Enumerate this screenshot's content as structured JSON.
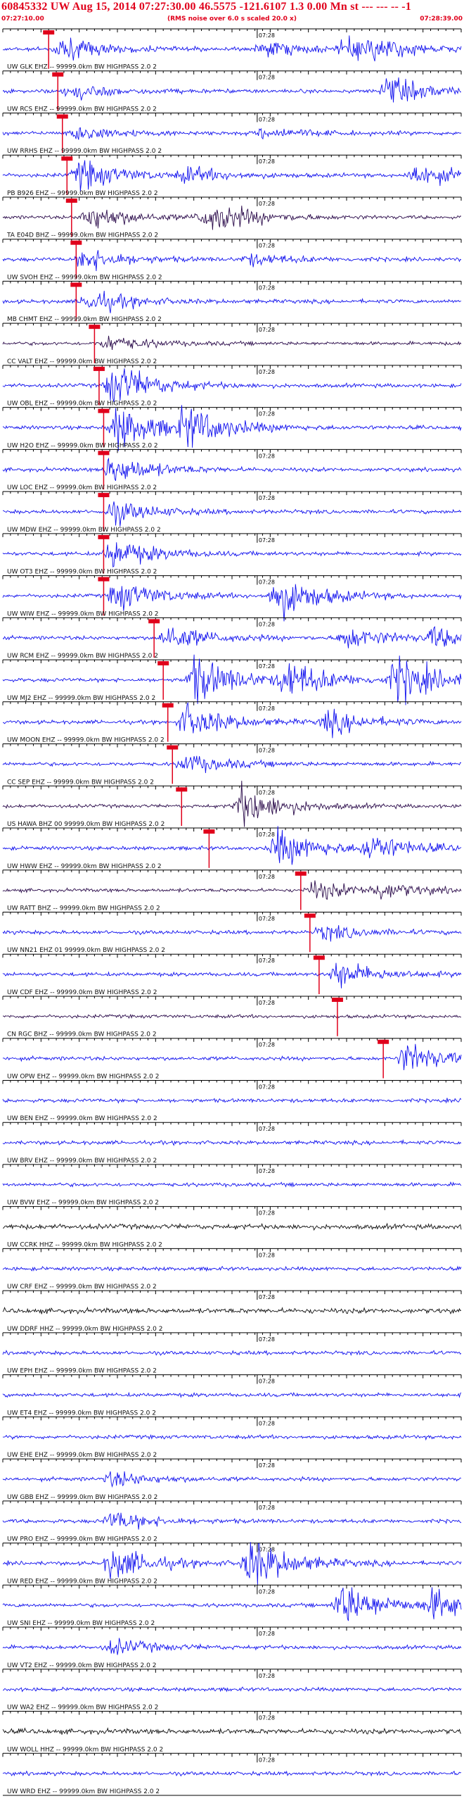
{
  "header": {
    "title": "60845332 UW Aug 15, 2014 07:27:30.00   46.5575 -121.6107  1.3 0.00 Mn st --- --- --  -1",
    "subtitle": "(RMS noise over 6.0 s scaled 20.0 x)",
    "start_time": "07:27:10.00",
    "end_time": "07:28:39.00"
  },
  "tick_label": "07:28",
  "colors": {
    "red": "#e0001b",
    "blue": "#1010ee",
    "dark": "#2a0a4a",
    "black": "#111111",
    "grid": "#000000"
  },
  "traces": [
    {
      "label": "UW GLK EHZ -- 99999.0km BW  HIGHPASS  2.0  2",
      "color": "blue",
      "pick": 0.1,
      "events": [
        [
          0.11,
          3.0
        ],
        [
          0.55,
          2.0
        ],
        [
          0.73,
          2.5
        ],
        [
          0.79,
          2.0
        ]
      ]
    },
    {
      "label": "UW RCS EHZ -- 99999.0km BW  HIGHPASS  2.0  2",
      "color": "blue",
      "pick": 0.12,
      "events": [
        [
          0.13,
          2.0
        ],
        [
          0.82,
          3.5
        ]
      ]
    },
    {
      "label": "UW RRHS EHZ -- 99999.0km BW  HIGHPASS  2.0  2",
      "color": "blue",
      "pick": 0.13,
      "events": [
        [
          0.14,
          2.0
        ],
        [
          0.55,
          1.5
        ]
      ]
    },
    {
      "label": "PB B926 EHZ -- 99999.0km BW  HIGHPASS  2.0  2",
      "color": "blue",
      "pick": 0.14,
      "events": [
        [
          0.15,
          4.0
        ],
        [
          0.38,
          2.0
        ],
        [
          0.88,
          3.0
        ]
      ]
    },
    {
      "label": "TA E04D BHZ -- 99999.0km BW  HIGHPASS  2.0  2",
      "color": "dark",
      "pick": 0.15,
      "events": [
        [
          0.17,
          3.5
        ],
        [
          0.42,
          2.5
        ],
        [
          0.45,
          2.0
        ]
      ]
    },
    {
      "label": "UW SVOH EHZ -- 99999.0km BW  HIGHPASS  2.0  2",
      "color": "blue",
      "pick": 0.16,
      "events": [
        [
          0.16,
          3.0
        ],
        [
          0.52,
          1.5
        ]
      ]
    },
    {
      "label": "MB CHMT EHZ -- 99999.0km BW  HIGHPASS  2.0  2",
      "color": "blue",
      "pick": 0.16,
      "events": [
        [
          0.17,
          3.0
        ]
      ]
    },
    {
      "label": "CC VALT EHZ -- 99999.0km BW  HIGHPASS  2.0  2",
      "color": "dark",
      "pick": 0.2,
      "events": [
        [
          0.21,
          2.0
        ]
      ]
    },
    {
      "label": "UW OBL EHZ -- 99999.0km BW  HIGHPASS  2.0  2",
      "color": "blue",
      "pick": 0.21,
      "events": [
        [
          0.22,
          6.0
        ]
      ]
    },
    {
      "label": "UW H2O EHZ -- 99999.0km BW  HIGHPASS  2.0  2",
      "color": "blue",
      "pick": 0.22,
      "events": [
        [
          0.23,
          6.0
        ],
        [
          0.38,
          5.0
        ]
      ]
    },
    {
      "label": "UW LOC EHZ -- 99999.0km BW  HIGHPASS  2.0  2",
      "color": "blue",
      "pick": 0.22,
      "events": [
        [
          0.22,
          4.0
        ]
      ]
    },
    {
      "label": "UW MDW EHZ -- 99999.0km BW  HIGHPASS  2.0  2",
      "color": "blue",
      "pick": 0.22,
      "events": [
        [
          0.22,
          3.0
        ]
      ]
    },
    {
      "label": "UW OT3 EHZ -- 99999.0km BW  HIGHPASS  2.0  2",
      "color": "blue",
      "pick": 0.22,
      "events": [
        [
          0.22,
          4.0
        ]
      ]
    },
    {
      "label": "UW WIW EHZ -- 99999.0km BW  HIGHPASS  2.0  2",
      "color": "blue",
      "pick": 0.22,
      "events": [
        [
          0.23,
          4.0
        ],
        [
          0.58,
          6.0
        ]
      ]
    },
    {
      "label": "UW RCM EHZ -- 99999.0km BW  HIGHPASS  2.0  2",
      "color": "blue",
      "pick": 0.33,
      "events": [
        [
          0.34,
          3.5
        ],
        [
          0.73,
          3.0
        ],
        [
          0.92,
          2.5
        ]
      ]
    },
    {
      "label": "UW MJ2 EHZ -- 99999.0km BW  HIGHPASS  2.0  2",
      "color": "blue",
      "pick": 0.35,
      "events": [
        [
          0.4,
          6.5
        ],
        [
          0.6,
          5.0
        ],
        [
          0.84,
          6.0
        ]
      ]
    },
    {
      "label": "UW MOON EHZ -- 99999.0km BW  HIGHPASS  2.0  2",
      "color": "blue",
      "pick": 0.36,
      "events": [
        [
          0.38,
          4.5
        ],
        [
          0.69,
          3.0
        ]
      ]
    },
    {
      "label": "CC SEP EHZ -- 99999.0km BW  HIGHPASS  2.0  2",
      "color": "blue",
      "pick": 0.37,
      "events": [
        [
          0.38,
          2.5
        ]
      ]
    },
    {
      "label": "US HAWA BHZ 00 99999.0km BW  HIGHPASS  2.0  2",
      "color": "dark",
      "pick": 0.39,
      "events": [
        [
          0.5,
          5.5
        ]
      ]
    },
    {
      "label": "UW HWW EHZ -- 99999.0km BW  HIGHPASS  2.0  2",
      "color": "blue",
      "pick": 0.45,
      "events": [
        [
          0.58,
          5.0
        ],
        [
          0.78,
          3.5
        ]
      ]
    },
    {
      "label": "UW RATT BHZ -- 99999.0km BW  HIGHPASS  2.0  2",
      "color": "dark",
      "pick": 0.65,
      "events": [
        [
          0.66,
          2.5
        ],
        [
          0.8,
          2.0
        ]
      ]
    },
    {
      "label": "UW NN21 EHZ 01 99999.0km BW  HIGHPASS  2.0  2",
      "color": "blue",
      "pick": 0.67,
      "events": [
        [
          0.68,
          2.0
        ]
      ]
    },
    {
      "label": "UW CDF EHZ -- 99999.0km BW  HIGHPASS  2.0  2",
      "color": "blue",
      "pick": 0.69,
      "events": [
        [
          0.71,
          3.5
        ]
      ]
    },
    {
      "label": "CN RGC BHZ -- 99999.0km BW  HIGHPASS  2.0  2",
      "color": "dark",
      "pick": 0.73,
      "events": []
    },
    {
      "label": "UW OPW EHZ -- 99999.0km BW  HIGHPASS  2.0  2",
      "color": "blue",
      "pick": 0.83,
      "events": [
        [
          0.86,
          4.0
        ]
      ]
    },
    {
      "label": "UW BEN EHZ -- 99999.0km BW  HIGHPASS  2.0  2",
      "color": "blue",
      "pick": null,
      "events": []
    },
    {
      "label": "UW BRV EHZ -- 99999.0km BW  HIGHPASS  2.0  2",
      "color": "blue",
      "pick": null,
      "events": []
    },
    {
      "label": "UW BVW EHZ -- 99999.0km BW  HIGHPASS  2.0  2",
      "color": "blue",
      "pick": null,
      "events": []
    },
    {
      "label": "UW CCRK HHZ -- 99999.0km BW  HIGHPASS  2.0  2",
      "color": "black",
      "pick": null,
      "events": []
    },
    {
      "label": "UW CRF EHZ -- 99999.0km BW  HIGHPASS  2.0  2",
      "color": "blue",
      "pick": null,
      "events": []
    },
    {
      "label": "UW DDRF HHZ -- 99999.0km BW  HIGHPASS  2.0  2",
      "color": "black",
      "pick": null,
      "events": []
    },
    {
      "label": "UW EPH EHZ -- 99999.0km BW  HIGHPASS  2.0  2",
      "color": "blue",
      "pick": null,
      "events": []
    },
    {
      "label": "UW ET4 EHZ -- 99999.0km BW  HIGHPASS  2.0  2",
      "color": "blue",
      "pick": null,
      "events": []
    },
    {
      "label": "UW EHE EHZ -- 99999.0km BW  HIGHPASS  2.0  2",
      "color": "blue",
      "pick": null,
      "events": []
    },
    {
      "label": "UW GBB EHZ -- 99999.0km BW  HIGHPASS  2.0  2",
      "color": "blue",
      "pick": null,
      "events": [
        [
          0.22,
          2.0
        ]
      ]
    },
    {
      "label": "UW PRO EHZ -- 99999.0km BW  HIGHPASS  2.0  2",
      "color": "blue",
      "pick": null,
      "events": [
        [
          0.22,
          2.5
        ]
      ]
    },
    {
      "label": "UW RED EHZ -- 99999.0km BW  HIGHPASS  2.0  2",
      "color": "blue",
      "pick": null,
      "events": [
        [
          0.22,
          4.5
        ],
        [
          0.52,
          6.5
        ]
      ]
    },
    {
      "label": "UW SNI EHZ -- 99999.0km BW  HIGHPASS  2.0  2",
      "color": "blue",
      "pick": null,
      "events": [
        [
          0.72,
          6.0
        ],
        [
          0.92,
          4.0
        ]
      ]
    },
    {
      "label": "UW VT2 EHZ -- 99999.0km BW  HIGHPASS  2.0  2",
      "color": "blue",
      "pick": null,
      "events": [
        [
          0.22,
          2.0
        ]
      ]
    },
    {
      "label": "UW WA2 EHZ -- 99999.0km BW  HIGHPASS  2.0  2",
      "color": "blue",
      "pick": null,
      "events": []
    },
    {
      "label": "UW WOLL HHZ -- 99999.0km BW  HIGHPASS  2.0  2",
      "color": "black",
      "pick": null,
      "events": []
    },
    {
      "label": "UW WRD EHZ -- 99999.0km BW  HIGHPASS  2.0  2",
      "color": "blue",
      "pick": null,
      "events": []
    }
  ]
}
